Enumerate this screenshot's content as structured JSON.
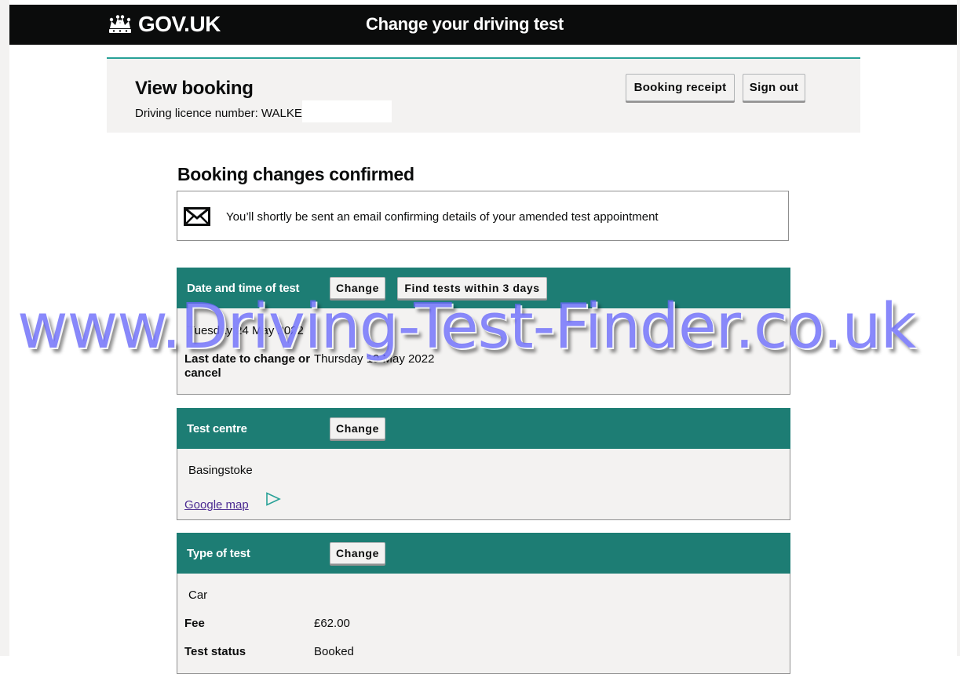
{
  "header": {
    "brand": "GOV.UK",
    "service_name": "Change your driving test",
    "crown_icon": "crown-icon"
  },
  "summary": {
    "title": "View booking",
    "licence_label": "Driving licence number: ",
    "licence_value": "WALKE",
    "booking_receipt_label": "Booking receipt",
    "sign_out_label": "Sign out"
  },
  "confirmation": {
    "title": "Booking changes confirmed",
    "notice_icon": "envelope-icon",
    "notice_text": "You’ll shortly be sent an email confirming details of your amended test appointment"
  },
  "date_card": {
    "heading": "Date and time of test",
    "change_label": "Change",
    "find_label": "Find tests within 3 days",
    "date_value": "Tuesday 24 May 2022",
    "last_change_label": "Last date to change or cancel",
    "last_change_value": "Thursday 19 May 2022"
  },
  "centre_card": {
    "heading": "Test centre",
    "change_label": "Change",
    "centre_value": "Basingstoke",
    "map_link": "Google map",
    "map_icon": "play-triangle-icon"
  },
  "type_card": {
    "heading": "Type of test",
    "change_label": "Change",
    "type_value": "Car",
    "fee_label": "Fee",
    "fee_value": "£62.00",
    "status_label": "Test status",
    "status_value": "Booked"
  },
  "watermark": "www.Driving-Test-Finder.co.uk",
  "colors": {
    "header_bg": "#0b0c0c",
    "accent_teal": "#1d7d74",
    "panel_grey": "#f3f2f1",
    "link_purple": "#4c2c92",
    "watermark": "#6868fa"
  }
}
